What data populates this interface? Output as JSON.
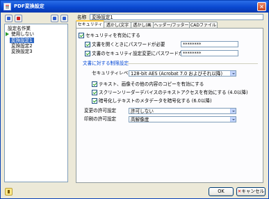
{
  "window": {
    "title": "PDF変換設定",
    "close_label": "×"
  },
  "list": {
    "header": "設定名作業",
    "items": [
      {
        "label": "使用しない",
        "selected": false,
        "current": true
      },
      {
        "label": "変換設定1",
        "selected": true,
        "current": false
      },
      {
        "label": "変換設定2",
        "selected": false,
        "current": false
      },
      {
        "label": "変換設定3",
        "selected": false,
        "current": false
      }
    ]
  },
  "name": {
    "label": "名称",
    "value": "変換設定1"
  },
  "tabs": [
    "セキュリティ",
    "透かし(文字列)",
    "透かし(画像)",
    "ヘッダー/フッター",
    "CADファイル"
  ],
  "security": {
    "enable_label": "セキュリティを有効にする",
    "open_password_label": "文書を開くときにパスワードが必要",
    "open_password_value": "********",
    "perm_password_label": "文書のセキュリティ設定変更にパスワードが必要",
    "perm_password_value": "********"
  },
  "perms": {
    "group_label": "文書に対する制限設定",
    "level_label": "セキュリティレベル",
    "level_value": "128-bit AES (Acrobat 7.0 およびそれ以降)",
    "copy_label": "テキスト、画像その他の内容のコピーを有効にする",
    "reader_label": "スクリーンリーダーデバイスのテキストアクセスを有効にする (4.0以降)",
    "meta_label": "暗号化しテキストのメタデータを暗号化する (6.0以降)",
    "change_label": "変更の許可設定",
    "change_value": "許可しない",
    "print_label": "印刷の許可設定",
    "print_value": "高解像度"
  },
  "buttons": {
    "ok": "OK",
    "cancel": "キャンセル",
    "cancel_prefix": "✕"
  },
  "icons": [
    "add-icon",
    "delete-icon",
    "move-up-icon",
    "move-down-icon",
    "help-icon",
    "current-arrow-icon"
  ]
}
